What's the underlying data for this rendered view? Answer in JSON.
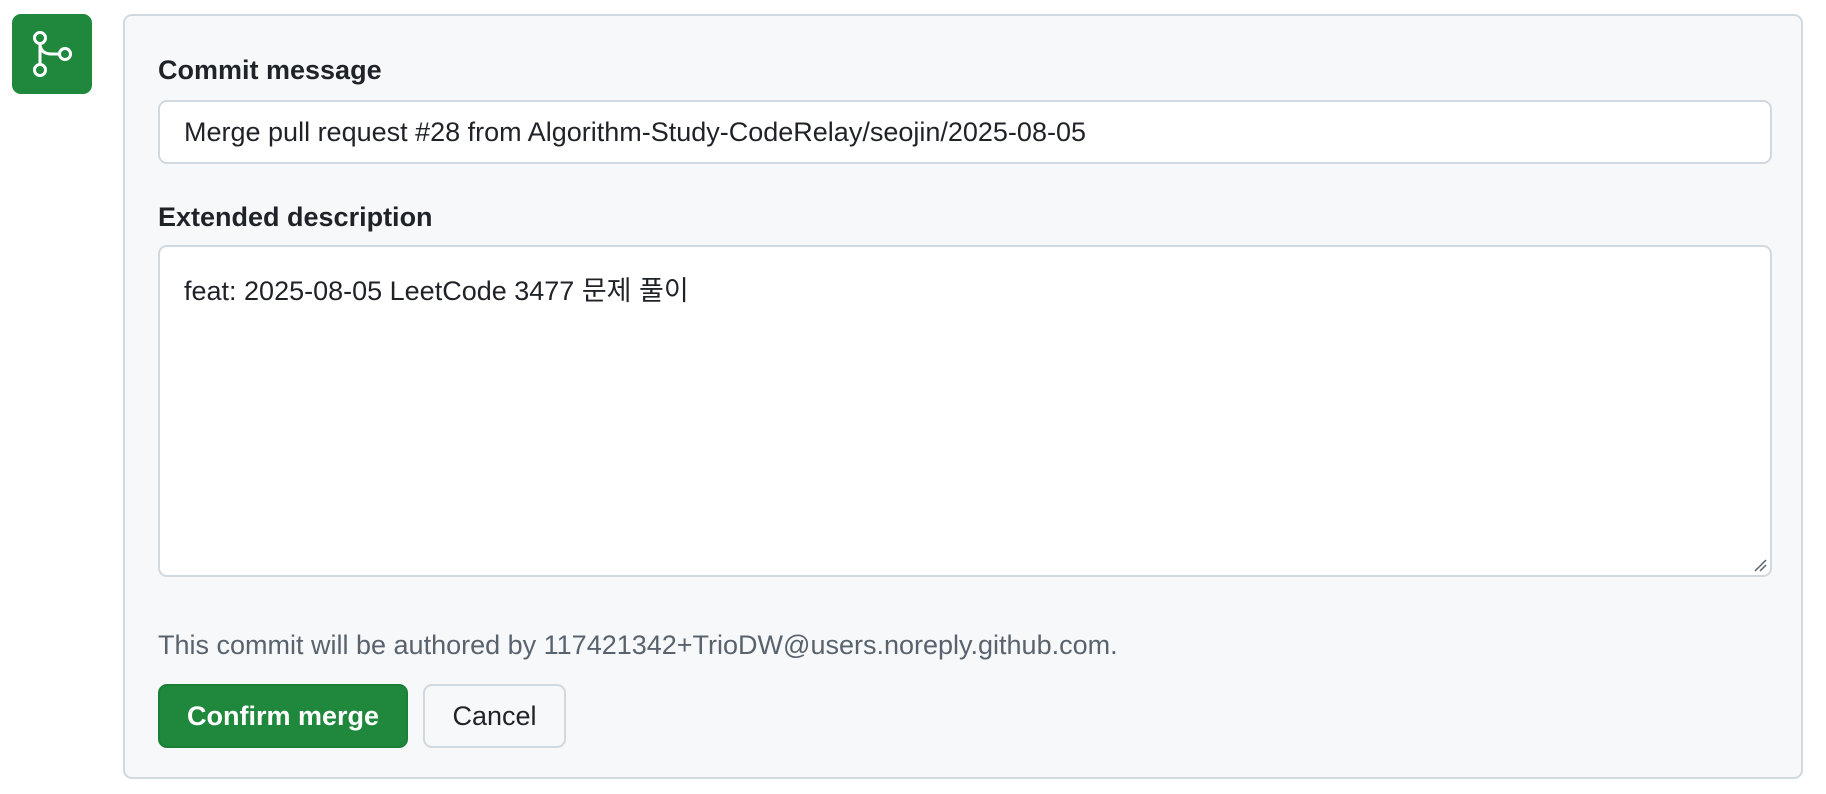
{
  "merge_icon": {
    "icon": "git-merge-icon",
    "color": "#1f883d"
  },
  "commit": {
    "label": "Commit message",
    "value": "Merge pull request #28 from Algorithm-Study-CodeRelay/seojin/2025-08-05"
  },
  "description": {
    "label": "Extended description",
    "value": "feat: 2025-08-05 LeetCode 3477 문제 풀이"
  },
  "author_note": "This commit will be authored by 117421342+TrioDW@users.noreply.github.com.",
  "buttons": {
    "confirm_label": "Confirm merge",
    "cancel_label": "Cancel"
  },
  "colors": {
    "accent": "#1f883d",
    "panel_bg": "#f6f8fa",
    "border": "#d1d9e0",
    "muted_text": "#59636e"
  }
}
